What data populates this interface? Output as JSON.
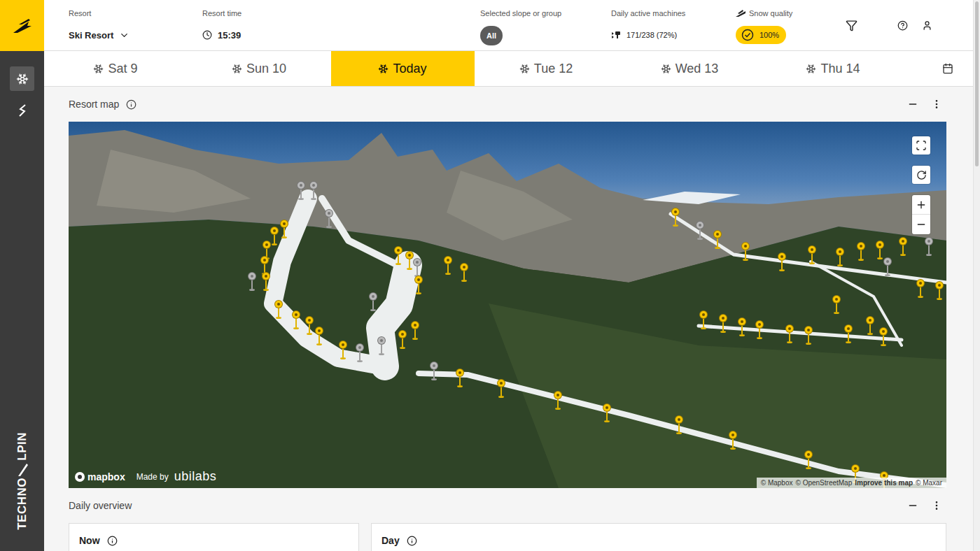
{
  "sidebar": {
    "items": [
      {
        "kind": "snowflake",
        "selected": true
      },
      {
        "kind": "gun",
        "selected": false
      }
    ]
  },
  "brand": {
    "left": "TECHNO",
    "right": "LPIN"
  },
  "header": {
    "resort": {
      "label": "Resort",
      "value": "Ski Resort"
    },
    "time": {
      "label": "Resort time",
      "value": "15:39"
    },
    "slope": {
      "label": "Selected slope or group",
      "value": "All"
    },
    "machines": {
      "label": "Daily active machines",
      "value": "171/238 (72%)"
    },
    "snow": {
      "label": "Snow quality",
      "value": "100%"
    }
  },
  "days": [
    {
      "label": "Sat 9",
      "selected": false
    },
    {
      "label": "Sun 10",
      "selected": false
    },
    {
      "label": "Today",
      "selected": true
    },
    {
      "label": "Tue 12",
      "selected": false
    },
    {
      "label": "Wed 13",
      "selected": false
    },
    {
      "label": "Thu 14",
      "selected": false
    }
  ],
  "map": {
    "title": "Resort map",
    "pins": [
      {
        "active": true
      },
      {
        "active": true
      },
      {
        "active": true
      },
      {
        "active": true
      },
      {
        "active": true
      },
      {
        "active": true
      },
      {
        "active": true
      },
      {
        "active": true
      },
      {
        "active": true
      },
      {
        "active": true
      },
      {
        "active": true
      },
      {
        "active": true
      },
      {
        "active": true
      },
      {
        "active": true
      },
      {
        "active": true
      },
      {
        "active": true
      },
      {
        "active": true
      },
      {
        "active": true
      },
      {
        "active": true
      },
      {
        "active": false
      },
      {
        "active": false
      },
      {
        "active": false
      },
      {
        "active": false
      },
      {
        "active": false
      },
      {
        "active": false
      },
      {
        "active": false
      },
      {
        "active": false
      },
      {
        "active": false
      },
      {
        "active": true
      },
      {
        "active": true
      },
      {
        "active": true
      },
      {
        "active": true
      },
      {
        "active": true
      },
      {
        "active": true
      },
      {
        "active": true
      },
      {
        "active": true
      },
      {
        "active": true
      },
      {
        "active": true
      },
      {
        "active": true
      },
      {
        "active": true
      },
      {
        "active": true
      },
      {
        "active": true
      },
      {
        "active": true
      },
      {
        "active": true
      },
      {
        "active": true
      },
      {
        "active": true
      },
      {
        "active": true
      },
      {
        "active": true
      },
      {
        "active": true
      },
      {
        "active": true
      },
      {
        "active": true
      },
      {
        "active": true
      },
      {
        "active": true
      },
      {
        "active": true
      },
      {
        "active": true
      },
      {
        "active": true
      },
      {
        "active": false
      },
      {
        "active": false
      },
      {
        "active": false
      }
    ],
    "attribution": {
      "logo": "mapbox",
      "made_by": "Made by",
      "maker": "ubilabs",
      "credits": [
        {
          "text": "© Mapbox",
          "kind": "plain"
        },
        {
          "text": "© OpenStreetMap",
          "kind": "plain"
        },
        {
          "text": "Improve this map",
          "kind": "link"
        },
        {
          "text": "© Maxar",
          "kind": "plain"
        }
      ]
    }
  },
  "overview": {
    "title": "Daily overview",
    "cards": [
      {
        "title": "Now"
      },
      {
        "title": "Day"
      }
    ]
  }
}
